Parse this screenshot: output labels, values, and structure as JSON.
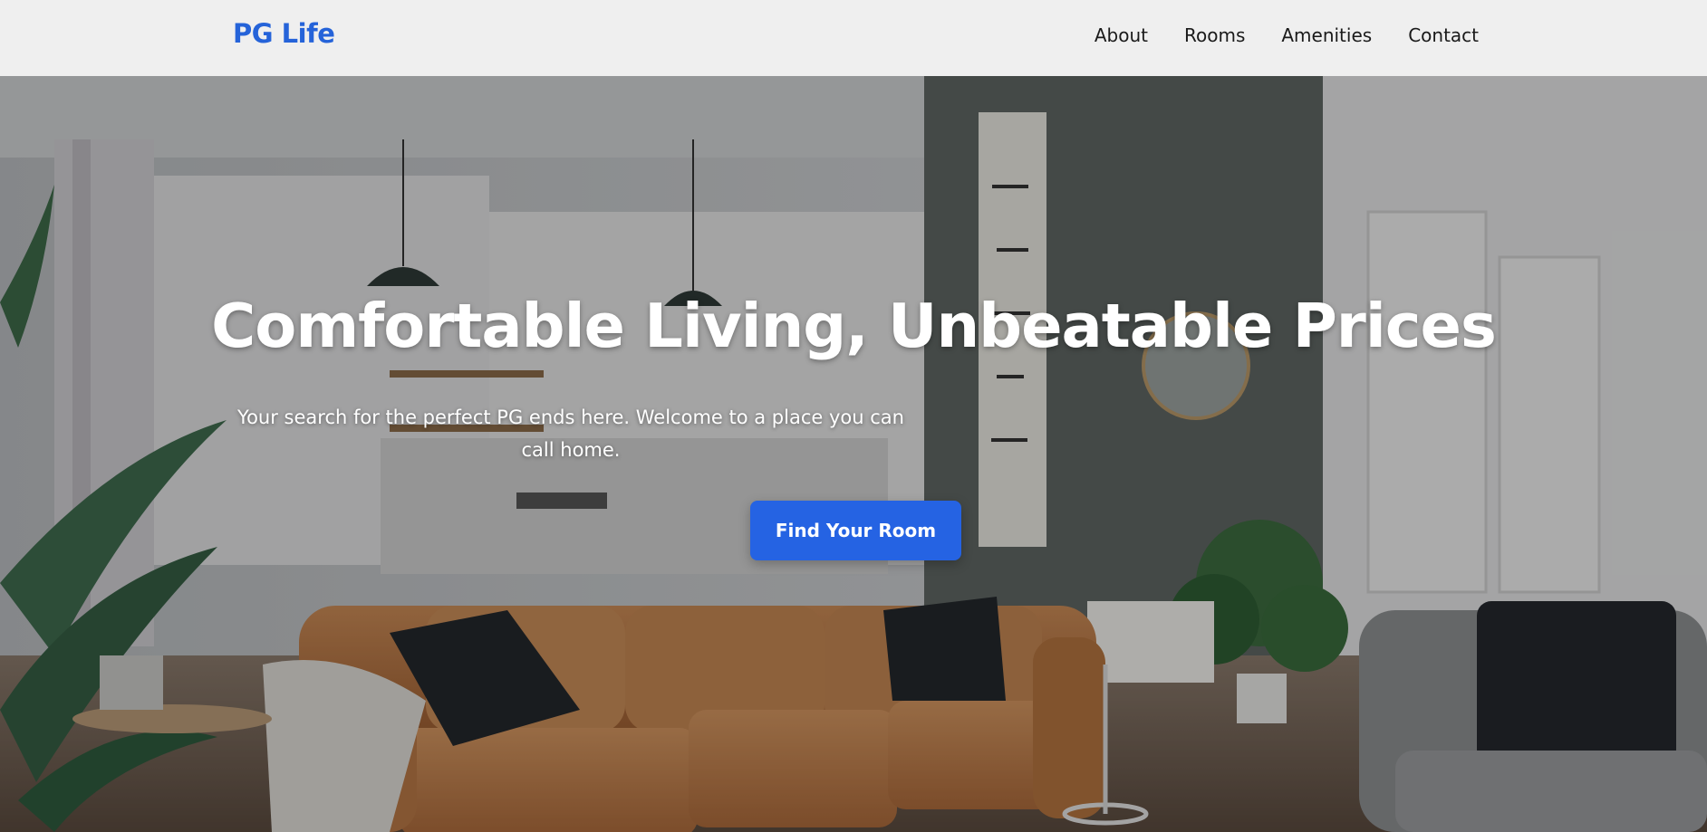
{
  "header": {
    "brand": "PG Life",
    "nav": [
      {
        "label": "About"
      },
      {
        "label": "Rooms"
      },
      {
        "label": "Amenities"
      },
      {
        "label": "Contact"
      }
    ]
  },
  "hero": {
    "title": "Comfortable Living, Unbeatable Prices",
    "subtitle": "Your search for the perfect PG ends here. Welcome to a place you can call home.",
    "cta_label": "Find Your Room"
  },
  "colors": {
    "brand": "#2563d9",
    "cta_background": "#2563e3",
    "nav_background": "#efefef",
    "hero_text": "#ffffff"
  }
}
